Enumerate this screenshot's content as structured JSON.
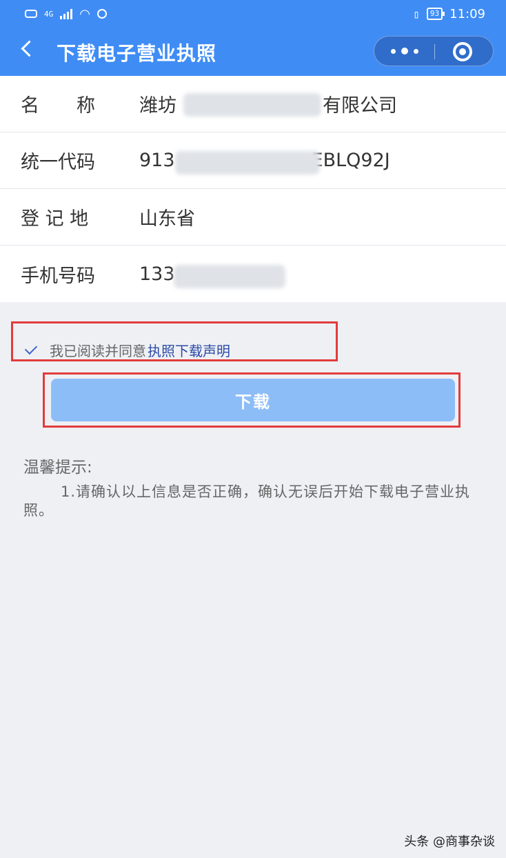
{
  "status_bar": {
    "network": "4G",
    "battery": "93",
    "time": "11:09"
  },
  "nav": {
    "title": "下载电子营业执照"
  },
  "fields": [
    {
      "label": "名　　称",
      "value_start": "潍坊",
      "value_end": "有限公司"
    },
    {
      "label": "统一代码",
      "value_start": "913",
      "value_end": "EBLQ92J"
    },
    {
      "label": "登 记 地",
      "value_start": "山东省",
      "value_end": ""
    },
    {
      "label": "手机号码",
      "value_start": "133",
      "value_end": ""
    }
  ],
  "agreement": {
    "text": "我已阅读并同意",
    "link": "执照下载声明",
    "checked": true
  },
  "download_button": "下载",
  "tips": {
    "title": "温馨提示:",
    "text": "1.请确认以上信息是否正确，确认无误后开始下载电子营业执照。"
  },
  "watermark": "头条 @商事杂谈",
  "colors": {
    "primary": "#3f8cf5",
    "button": "#8dbdf7",
    "highlight": "#e23b3b"
  }
}
